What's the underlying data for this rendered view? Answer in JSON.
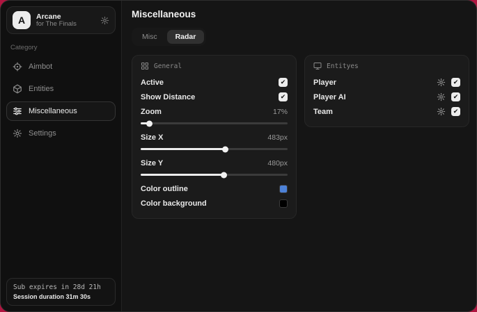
{
  "colors": {
    "desktop": "#b01540",
    "window_bg": "#151515",
    "panel_bg": "#1b1b1b",
    "outline_swatch": "#4d82d8",
    "background_swatch": "#000000"
  },
  "sidebar": {
    "app": {
      "initial": "A",
      "name": "Arcane",
      "subtitle": "for The Finals"
    },
    "category_label": "Category",
    "items": [
      {
        "label": "Aimbot",
        "icon": "crosshair-icon",
        "active": false
      },
      {
        "label": "Entities",
        "icon": "cube-icon",
        "active": false
      },
      {
        "label": "Miscellaneous",
        "icon": "sliders-icon",
        "active": true
      },
      {
        "label": "Settings",
        "icon": "gear-icon",
        "active": false
      }
    ],
    "footer": {
      "line1": "Sub expires in 28d 21h",
      "line2": "Session duration 31m 30s"
    }
  },
  "main": {
    "title": "Miscellaneous",
    "tabs": [
      {
        "label": "Misc",
        "active": false
      },
      {
        "label": "Radar",
        "active": true
      }
    ],
    "general": {
      "title": "General",
      "toggles": [
        {
          "label": "Active",
          "checked": true,
          "check": "✔"
        },
        {
          "label": "Show Distance",
          "checked": true,
          "check": "✔"
        }
      ],
      "sliders": [
        {
          "label": "Zoom",
          "value": "17%",
          "percent": 6
        },
        {
          "label": "Size X",
          "value": "483px",
          "percent": 58
        },
        {
          "label": "Size Y",
          "value": "480px",
          "percent": 57
        }
      ],
      "colors": [
        {
          "label": "Color outline",
          "color": "#4d82d8"
        },
        {
          "label": "Color background",
          "color": "#000000"
        }
      ]
    },
    "entities": {
      "title": "Entityes",
      "items": [
        {
          "label": "Player",
          "checked": true,
          "check": "✔"
        },
        {
          "label": "Player AI",
          "checked": true,
          "check": "✔"
        },
        {
          "label": "Team",
          "checked": true,
          "check": "✔"
        }
      ]
    }
  }
}
